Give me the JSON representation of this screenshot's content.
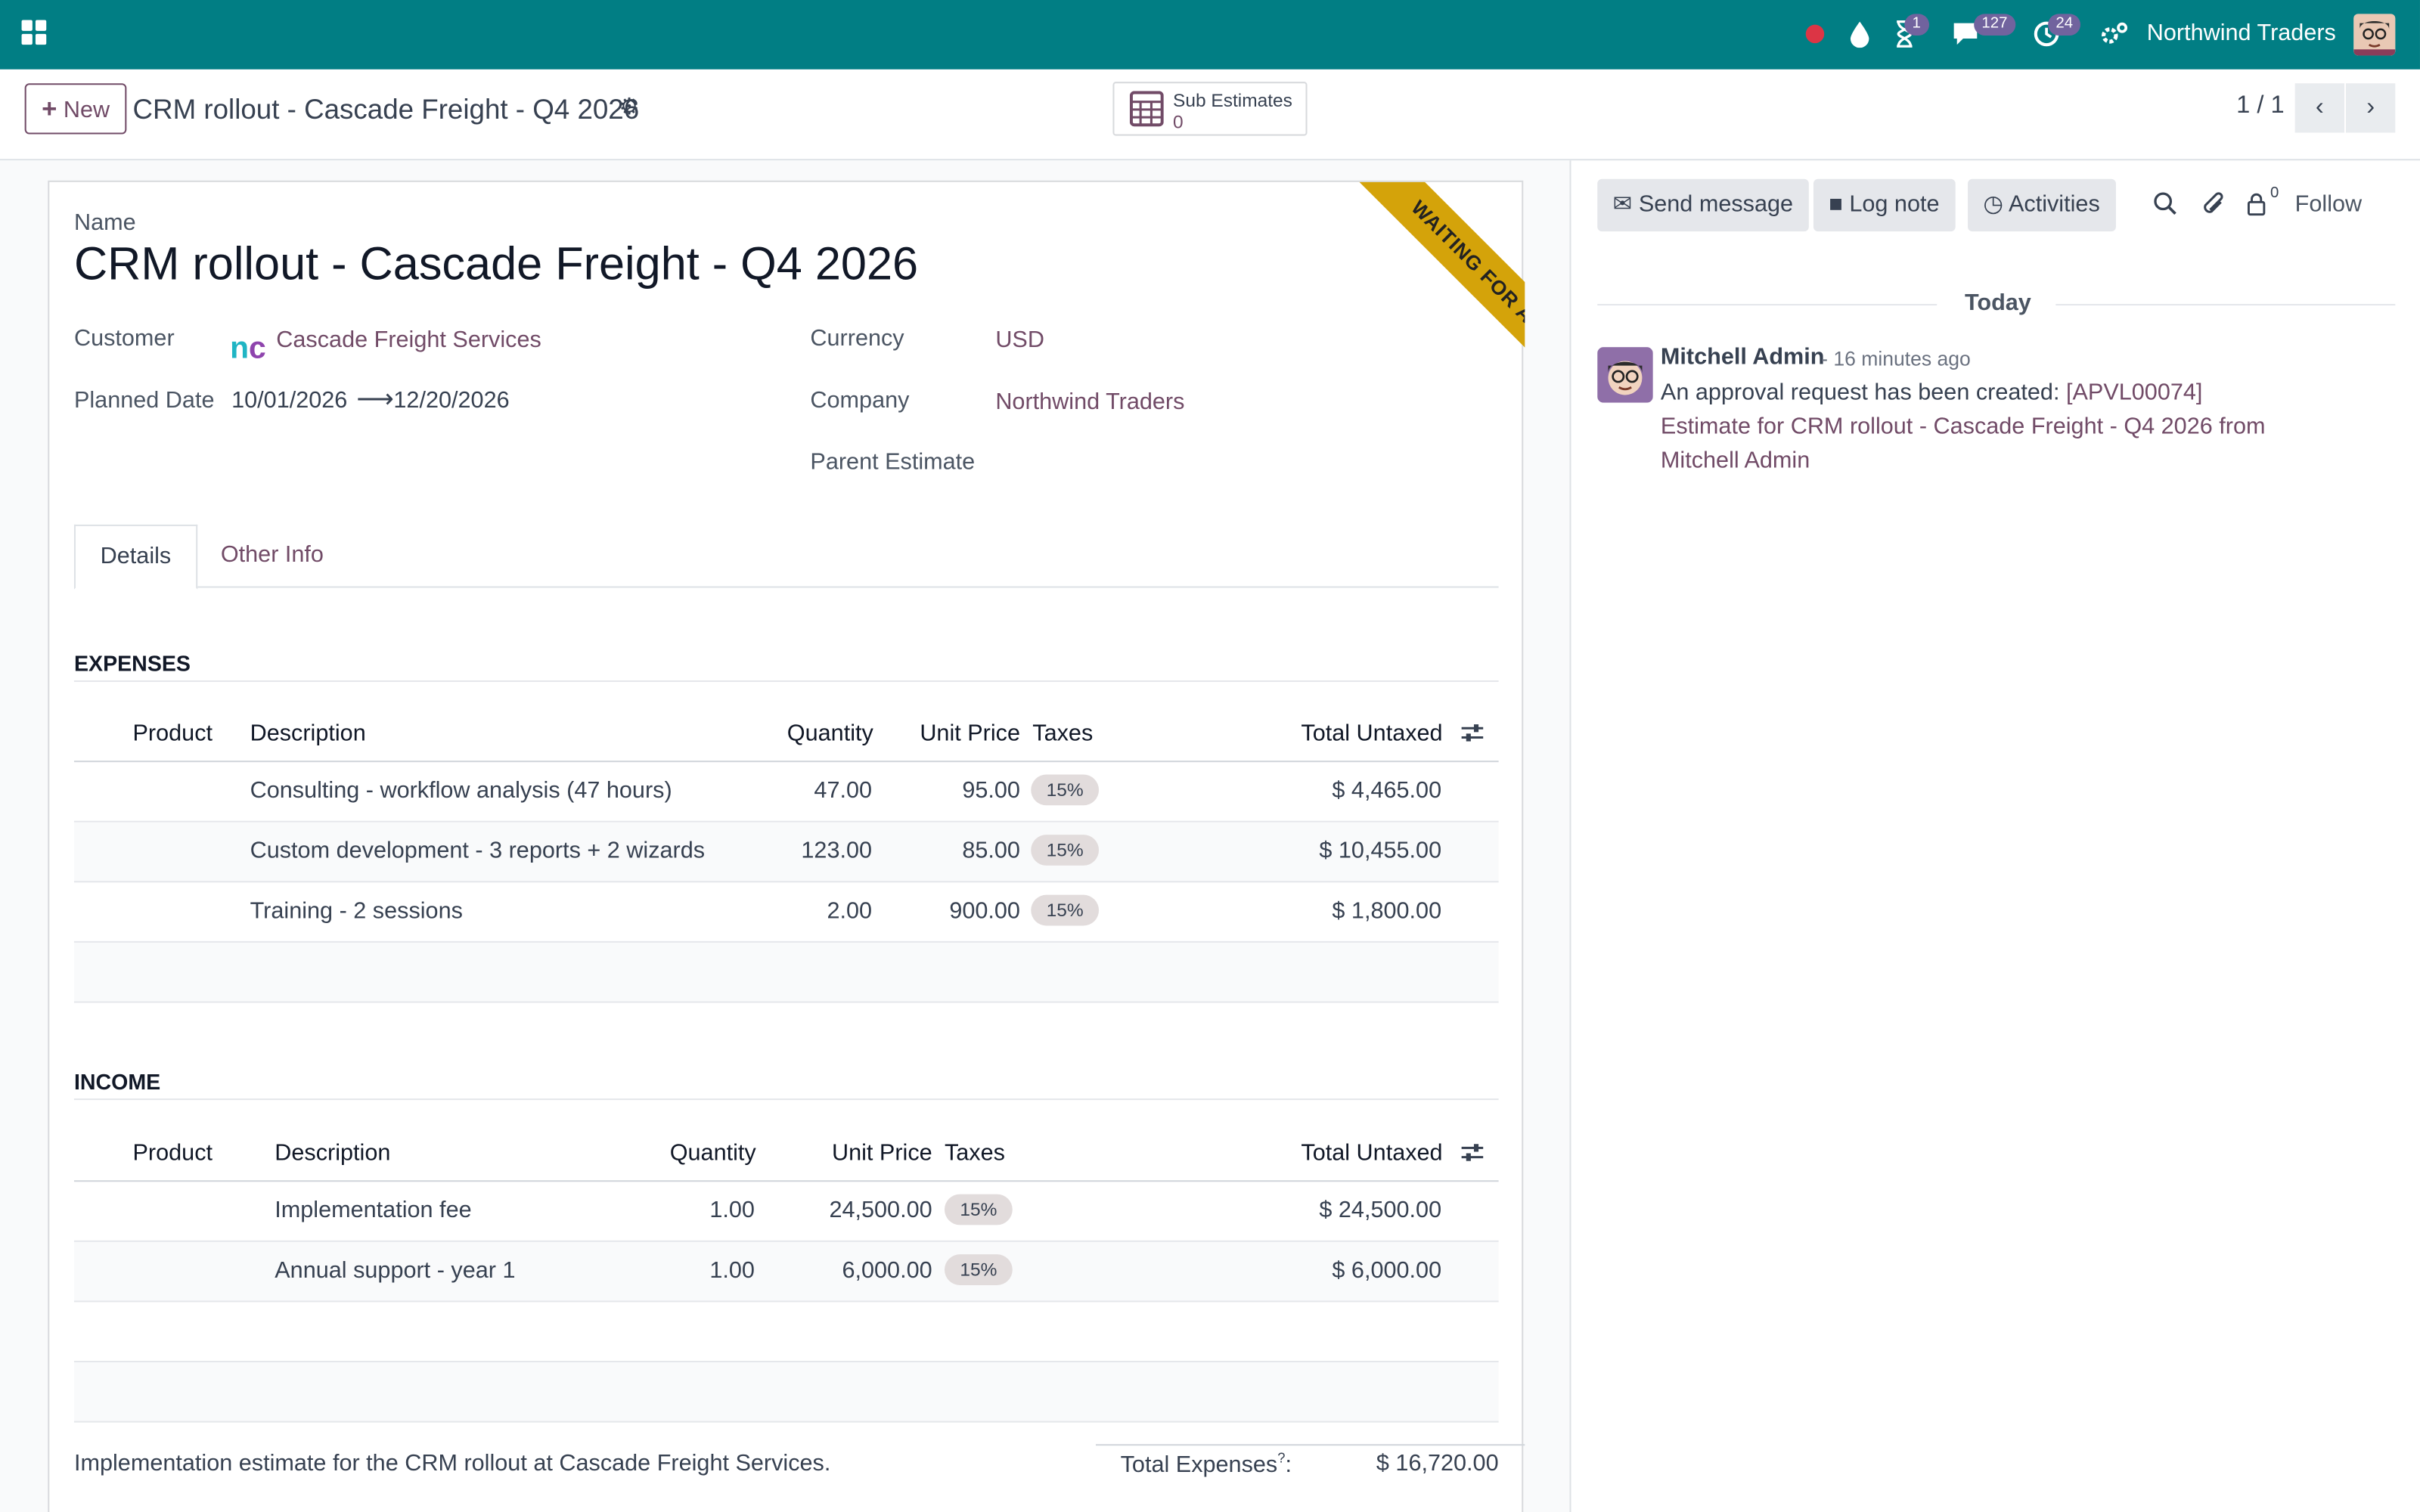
{
  "topbar": {
    "company": "Northwind Traders",
    "badges": {
      "activity": "1",
      "messages": "127",
      "clock": "24"
    },
    "icons": [
      "apps-icon",
      "record-icon",
      "drop-icon",
      "hourglass-icon",
      "chat-icon",
      "clock-icon",
      "settings-icon"
    ],
    "bg_color": "#017e84"
  },
  "control": {
    "new_label": "New",
    "breadcrumb": "CRM rollout - Cascade Freight - Q4 2026",
    "smart_button_label": "Sub Estimates",
    "smart_button_count": "0",
    "pager": "1 / 1"
  },
  "form": {
    "ribbon": "WAITING FOR APPROVAL",
    "name_label": "Name",
    "name_value": "CRM rollout - Cascade Freight - Q4 2026",
    "customer_label": "Customer",
    "customer_value": "Cascade Freight Services",
    "customer_logo_text": "nc",
    "planned_date_label": "Planned Date",
    "planned_start": "10/01/2026",
    "planned_end": "12/20/2026",
    "currency_label": "Currency",
    "currency_value": "USD",
    "company_label": "Company",
    "company_value": "Northwind Traders",
    "parent_label": "Parent Estimate",
    "tabs": [
      "Details",
      "Other Info"
    ]
  },
  "expenses": {
    "title": "EXPENSES",
    "headers": [
      "Product",
      "Description",
      "Quantity",
      "Unit Price",
      "Taxes",
      "Total Untaxed"
    ],
    "rows": [
      {
        "description": "Consulting - workflow analysis (47 hours)",
        "quantity": "47.00",
        "unit_price": "95.00",
        "tax": "15%",
        "total": "$ 4,465.00"
      },
      {
        "description": "Custom development - 3 reports + 2 wizards",
        "quantity": "123.00",
        "unit_price": "85.00",
        "tax": "15%",
        "total": "$ 10,455.00"
      },
      {
        "description": "Training - 2 sessions",
        "quantity": "2.00",
        "unit_price": "900.00",
        "tax": "15%",
        "total": "$ 1,800.00"
      }
    ]
  },
  "income": {
    "title": "INCOME",
    "headers": [
      "Product",
      "Description",
      "Quantity",
      "Unit Price",
      "Taxes",
      "Total Untaxed"
    ],
    "rows": [
      {
        "description": "Implementation fee",
        "quantity": "1.00",
        "unit_price": "24,500.00",
        "tax": "15%",
        "total": "$ 24,500.00"
      },
      {
        "description": "Annual support - year 1",
        "quantity": "1.00",
        "unit_price": "6,000.00",
        "tax": "15%",
        "total": "$ 6,000.00"
      }
    ]
  },
  "footer": {
    "notes": "Implementation estimate for the CRM rollout at Cascade Freight Services.",
    "total_expenses_label": "Total Expenses",
    "total_expenses_sup": "?",
    "total_expenses_value": "$ 16,720.00"
  },
  "chatter": {
    "send_message": "Send message",
    "log_note": "Log note",
    "activities": "Activities",
    "follower_count": "0",
    "follow": "Follow",
    "today": "Today",
    "message": {
      "author": "Mitchell Admin",
      "time": "- 16 minutes ago",
      "text": "An approval request has been created: ",
      "link": "[APVL00074] Estimate for CRM rollout - Cascade Freight - Q4 2026 from Mitchell Admin"
    }
  },
  "colors": {
    "brand": "#714b67",
    "ribbon": "#d4a30a",
    "tax_pill": "#e2dcdc"
  }
}
